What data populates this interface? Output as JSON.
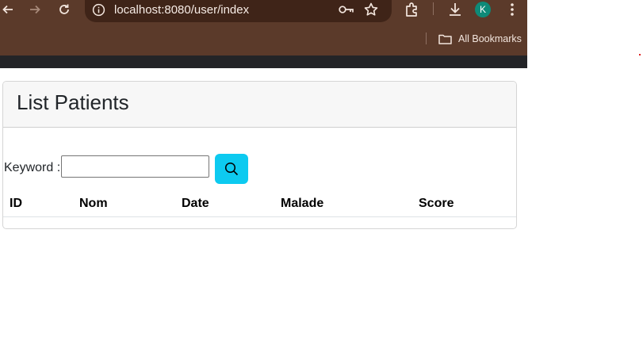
{
  "browser": {
    "url": "localhost:8080/user/index",
    "profile_initial": "K",
    "bookmarks_label": "All Bookmarks"
  },
  "page": {
    "title": "List Patients",
    "search": {
      "label": "Keyword :",
      "value": "",
      "placeholder": ""
    },
    "table": {
      "headers": [
        "ID",
        "Nom",
        "Date",
        "Malade",
        "Score"
      ],
      "rows": []
    }
  },
  "colors": {
    "browser_frame": "#5b3a2a",
    "search_button": "#0dcaf0",
    "avatar": "#0e8a78"
  }
}
